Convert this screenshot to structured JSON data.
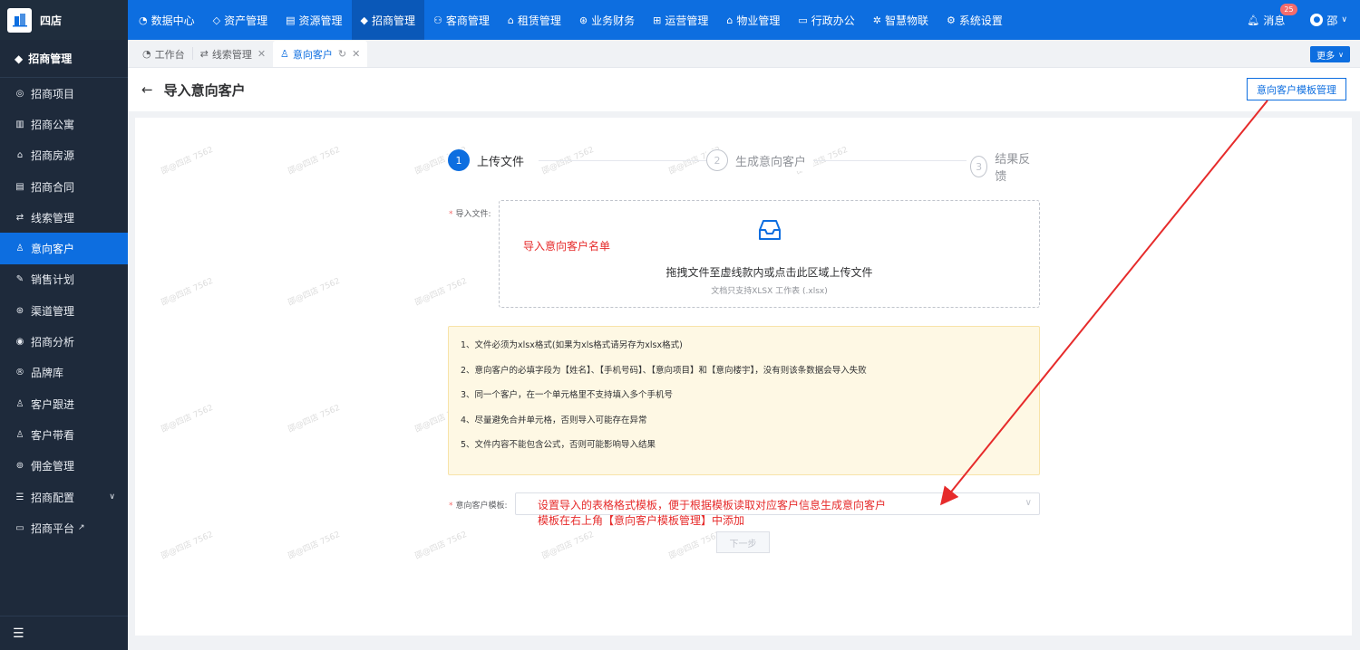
{
  "app": {
    "name": "四店"
  },
  "topnav": {
    "items": [
      {
        "label": "数据中心",
        "icon": "chart-icon"
      },
      {
        "label": "资产管理",
        "icon": "cube-icon"
      },
      {
        "label": "资源管理",
        "icon": "building-icon"
      },
      {
        "label": "招商管理",
        "icon": "tag-icon",
        "active": true
      },
      {
        "label": "客商管理",
        "icon": "users-icon"
      },
      {
        "label": "租赁管理",
        "icon": "home-icon"
      },
      {
        "label": "业务财务",
        "icon": "coin-icon"
      },
      {
        "label": "运营管理",
        "icon": "grid-icon"
      },
      {
        "label": "物业管理",
        "icon": "house-icon"
      },
      {
        "label": "行政办公",
        "icon": "monitor-icon"
      },
      {
        "label": "智慧物联",
        "icon": "network-icon"
      },
      {
        "label": "系统设置",
        "icon": "gear-icon"
      }
    ],
    "messages_label": "消息",
    "messages_count": "25",
    "user_name": "邵"
  },
  "sidebar": {
    "header": "招商管理",
    "items": [
      {
        "label": "招商项目"
      },
      {
        "label": "招商公寓"
      },
      {
        "label": "招商房源"
      },
      {
        "label": "招商合同"
      },
      {
        "label": "线索管理"
      },
      {
        "label": "意向客户",
        "active": true
      },
      {
        "label": "销售计划"
      },
      {
        "label": "渠道管理"
      },
      {
        "label": "招商分析"
      },
      {
        "label": "品牌库"
      },
      {
        "label": "客户跟进"
      },
      {
        "label": "客户带看"
      },
      {
        "label": "佣金管理"
      },
      {
        "label": "招商配置"
      },
      {
        "label": "招商平台"
      }
    ]
  },
  "tabs": [
    {
      "label": "工作台"
    },
    {
      "label": "线索管理"
    },
    {
      "label": "意向客户"
    }
  ],
  "more_label": "更多",
  "page": {
    "title": "导入意向客户",
    "template_button": "意向客户模板管理"
  },
  "steps": [
    {
      "num": "1",
      "label": "上传文件"
    },
    {
      "num": "2",
      "label": "生成意向客户"
    },
    {
      "num": "3",
      "label": "结果反馈"
    }
  ],
  "upload": {
    "label": "导入文件:",
    "main_text": "拖拽文件至虚线款内或点击此区域上传文件",
    "sub_text": "文档只支持XLSX 工作表 (.xlsx)",
    "annotation": "导入意向客户名单"
  },
  "notice": [
    "1、文件必须为xlsx格式(如果为xls格式请另存为xlsx格式)",
    "2、意向客户的必填字段为【姓名】、【手机号码】、【意向项目】和【意向楼宇】，没有则该条数据会导入失败",
    "3、同一个客户，在一个单元格里不支持填入多个手机号",
    "4、尽量避免合并单元格，否则导入可能存在异常",
    "5、文件内容不能包含公式，否则可能影响导入结果"
  ],
  "template_select": {
    "label": "意向客户模板:",
    "annotation_line1": "设置导入的表格格式模板，便于根据模板读取对应客户信息生成意向客户",
    "annotation_line2": "模板在右上角【意向客户模板管理】中添加"
  },
  "next_button": "下一步",
  "watermark": "邵@四店 7562",
  "colors": {
    "primary": "#0d6ee0",
    "sidebar_bg": "#1e2a3b",
    "annotation": "#e62b2b",
    "notice_bg": "#fef8e4"
  }
}
